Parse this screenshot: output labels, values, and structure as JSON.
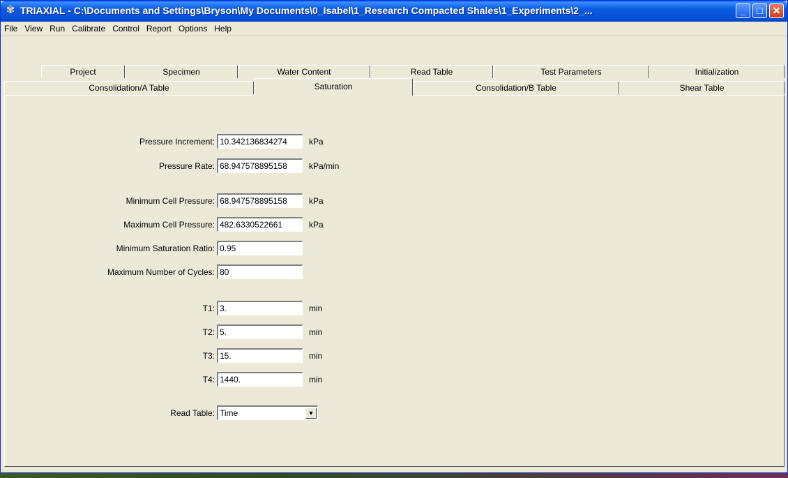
{
  "window": {
    "title": "TRIAXIAL - C:\\Documents and Settings\\Bryson\\My Documents\\0_Isabel\\1_Research Compacted Shales\\1_Experiments\\2_...",
    "icon": "gear-flower-icon",
    "controls": {
      "minimize": "_",
      "maximize": "□",
      "close": "✕"
    }
  },
  "menu": [
    "File",
    "View",
    "Run",
    "Calibrate",
    "Control",
    "Report",
    "Options",
    "Help"
  ],
  "tabs_row1": [
    "Project",
    "Specimen",
    "Water Content",
    "Read Table",
    "Test Parameters",
    "Initialization"
  ],
  "tabs_row2": [
    "Consolidation/A Table",
    "Saturation",
    "Consolidation/B Table",
    "Shear Table"
  ],
  "active_tab": "Saturation",
  "form": {
    "pressure_increment": {
      "label": "Pressure Increment:",
      "value": "10.342136834274",
      "unit": "kPa"
    },
    "pressure_rate": {
      "label": "Pressure Rate:",
      "value": "68.947578895158",
      "unit": "kPa/min"
    },
    "min_cell_pressure": {
      "label": "Minimum Cell Pressure:",
      "value": "68.947578895158",
      "unit": "kPa"
    },
    "max_cell_pressure": {
      "label": "Maximum Cell Pressure:",
      "value": "482.6330522661",
      "unit": "kPa"
    },
    "min_saturation_ratio": {
      "label": "Minimum Saturation Ratio:",
      "value": "0.95"
    },
    "max_cycles": {
      "label": "Maximum Number of Cycles:",
      "value": "80"
    },
    "t1": {
      "label": "T1:",
      "value": "3.",
      "unit": "min"
    },
    "t2": {
      "label": "T2:",
      "value": "5.",
      "unit": "min"
    },
    "t3": {
      "label": "T3:",
      "value": "15.",
      "unit": "min"
    },
    "t4": {
      "label": "T4:",
      "value": "1440.",
      "unit": "min"
    },
    "read_table": {
      "label": "Read Table:",
      "value": "Time"
    }
  }
}
